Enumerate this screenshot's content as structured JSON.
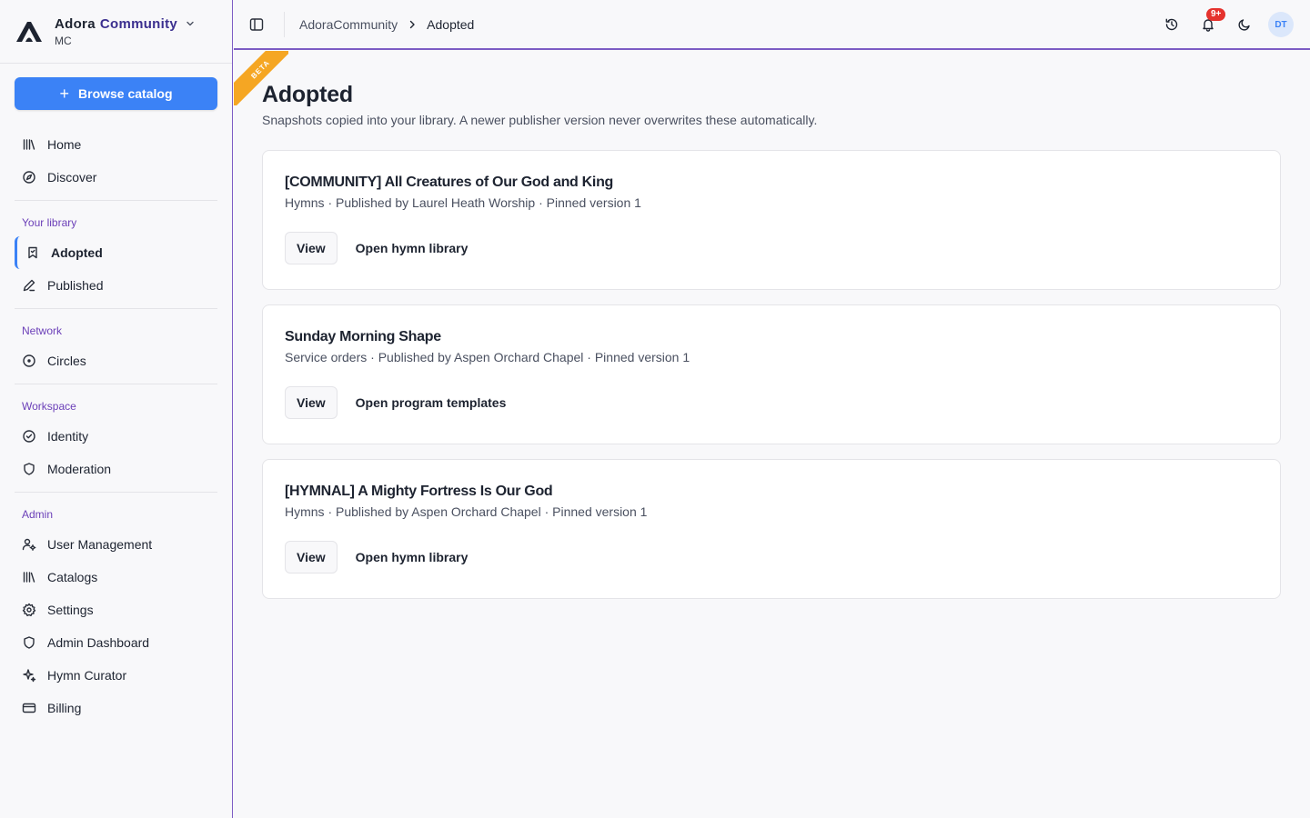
{
  "brand": {
    "name_first": "Adora",
    "name_second": "Community",
    "org_code": "MC"
  },
  "sidebar": {
    "browse_label": "Browse catalog",
    "primary": [
      {
        "label": "Home",
        "icon": "library-icon"
      },
      {
        "label": "Discover",
        "icon": "compass-icon"
      }
    ],
    "sections": [
      {
        "title": "Your library",
        "items": [
          {
            "label": "Adopted",
            "icon": "bookmark-icon",
            "active": true
          },
          {
            "label": "Published",
            "icon": "pen-icon"
          }
        ]
      },
      {
        "title": "Network",
        "items": [
          {
            "label": "Circles",
            "icon": "circle-dot-icon"
          }
        ]
      },
      {
        "title": "Workspace",
        "items": [
          {
            "label": "Identity",
            "icon": "badge-check-icon"
          },
          {
            "label": "Moderation",
            "icon": "shield-icon"
          }
        ]
      },
      {
        "title": "Admin",
        "items": [
          {
            "label": "User Management",
            "icon": "user-cog-icon"
          },
          {
            "label": "Catalogs",
            "icon": "library-icon"
          },
          {
            "label": "Settings",
            "icon": "gear-icon"
          },
          {
            "label": "Admin Dashboard",
            "icon": "shield-icon"
          },
          {
            "label": "Hymn Curator",
            "icon": "sparkles-icon"
          },
          {
            "label": "Billing",
            "icon": "credit-card-icon"
          }
        ]
      }
    ]
  },
  "header": {
    "breadcrumb": [
      "AdoraCommunity",
      "Adopted"
    ],
    "notification_badge": "9+",
    "avatar_initials": "DT"
  },
  "ribbon": "BETA",
  "page": {
    "title": "Adopted",
    "description": "Snapshots copied into your library. A newer publisher version never overwrites these automatically."
  },
  "cards": [
    {
      "title": "[COMMUNITY] All Creatures of Our God and King",
      "meta": "Hymns · Published by Laurel Heath Worship · Pinned version 1",
      "view_label": "View",
      "link_label": "Open hymn library"
    },
    {
      "title": "Sunday Morning Shape",
      "meta": "Service orders · Published by Aspen Orchard Chapel · Pinned version 1",
      "view_label": "View",
      "link_label": "Open program templates"
    },
    {
      "title": "[HYMNAL] A Mighty Fortress Is Our God",
      "meta": "Hymns · Published by Aspen Orchard Chapel · Pinned version 1",
      "view_label": "View",
      "link_label": "Open hymn library"
    }
  ],
  "colors": {
    "accent_blue": "#3b82f6",
    "accent_purple": "#7c5cc4",
    "ribbon_orange": "#f5a623",
    "badge_red": "#e5322d"
  }
}
